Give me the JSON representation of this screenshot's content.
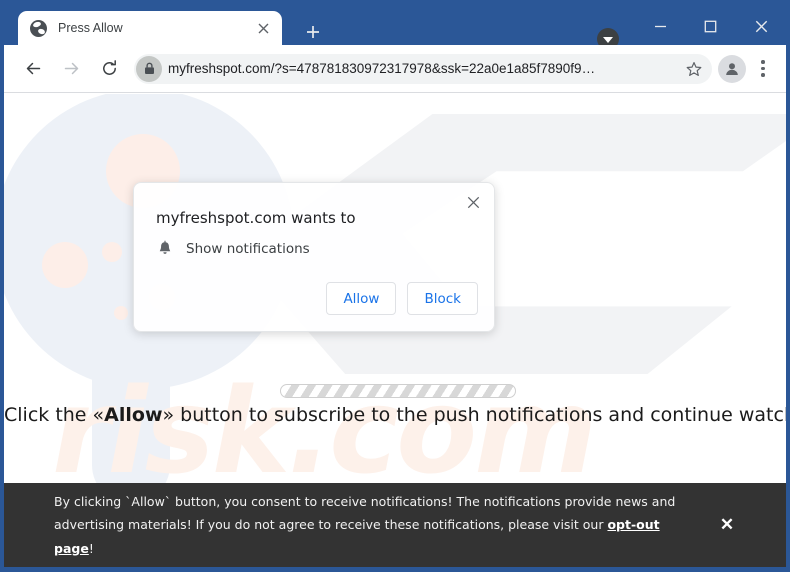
{
  "browser": {
    "tab": {
      "title": "Press Allow",
      "favicon": "globe-icon",
      "close_label": "×"
    },
    "new_tab_label": "+",
    "tab_search_icon": "chevron-down-circle-icon",
    "window_controls": {
      "minimize": "minimize-icon",
      "maximize": "maximize-icon",
      "close": "close-icon"
    },
    "toolbar": {
      "back_icon": "arrow-left-icon",
      "forward_icon": "arrow-right-icon",
      "reload_icon": "reload-icon",
      "lock_icon": "lock-icon",
      "url": "myfreshspot.com/?s=478781830972317978&ssk=22a0e1a85f7890f9…",
      "star_icon": "star-icon",
      "profile_icon": "person-icon",
      "menu_icon": "three-dot-menu-icon"
    }
  },
  "permission_dialog": {
    "title": "myfreshspot.com wants to",
    "item_icon": "bell-icon",
    "item_label": "Show notifications",
    "allow_label": "Allow",
    "block_label": "Block",
    "close_label": "×"
  },
  "page": {
    "watermark_text": "risk.com",
    "headline_prefix": "Click the «",
    "headline_strong": "Allow",
    "headline_suffix": "» button to subscribe to the push notifications and continue watching",
    "progress_label": "loading-progress-bar"
  },
  "consent_banner": {
    "line1": "By clicking `Allow` button, you consent to receive notifications! The notifications provide news and",
    "line2_before": "advertising materials! If you do not agree to receive these notifications, please visit our ",
    "link": "opt-out page",
    "line2_after": "!",
    "close_label": "✕"
  },
  "colors": {
    "window_frame": "#2b5797",
    "banner_bg": "#333333",
    "link_blue": "#1a73e8",
    "watermark_peach": "#fdf1ea"
  }
}
